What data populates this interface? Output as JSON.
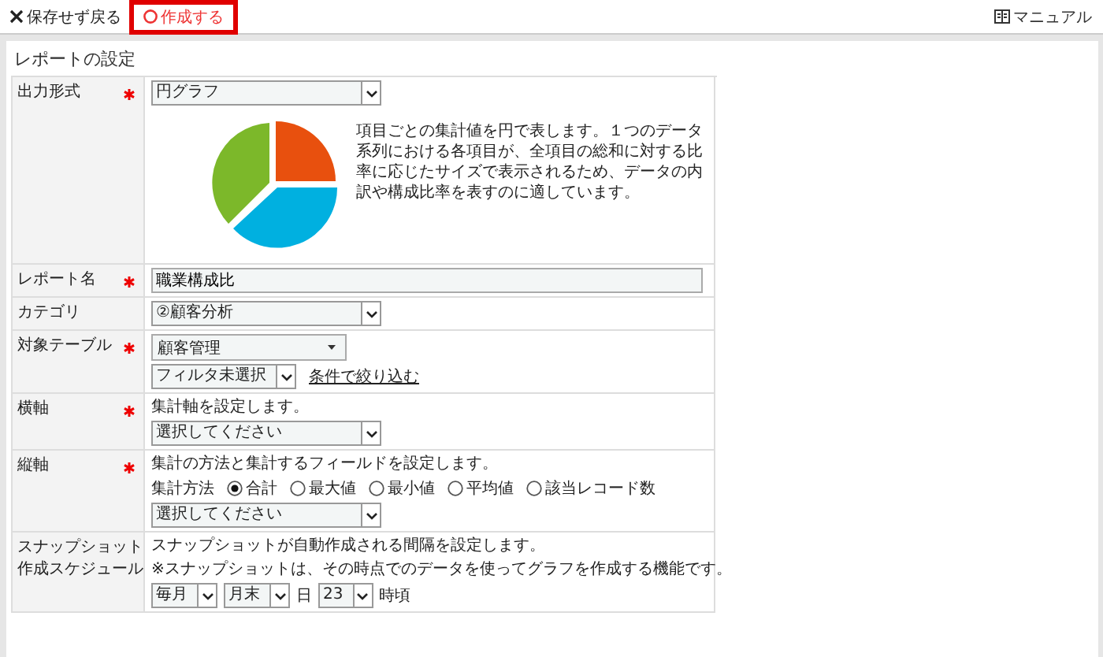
{
  "toolbar": {
    "back_button": {
      "label": "保存せず戻る"
    },
    "create_button": {
      "label": "作成する",
      "highlighted": true
    },
    "manual_link": {
      "label": "マニュアル"
    }
  },
  "panel": {
    "title": "レポートの設定",
    "rows": [
      {
        "label": [
          "出力形式"
        ],
        "required": true,
        "lines": [
          [
            {
              "kind": "select",
              "value": "円グラフ"
            }
          ],
          [
            {
              "kind": "preview",
              "description": "項目ごとの集計値を円で表します。１つのデータ系列における各項目が、全項目の総和に対する比率に応じたサイズで表示されるため、データの内訳や構成比率を表すのに適しています。"
            }
          ]
        ]
      },
      {
        "label": [
          "レポート名"
        ],
        "required": true,
        "lines": [
          [
            {
              "kind": "text_input",
              "value": "職業構成比"
            }
          ]
        ]
      },
      {
        "label": [
          "カテゴリ"
        ],
        "required": false,
        "lines": [
          [
            {
              "kind": "select",
              "value": "②顧客分析"
            }
          ]
        ]
      },
      {
        "label": [
          "対象テーブル"
        ],
        "required": true,
        "lines": [
          [
            {
              "kind": "dropdown",
              "value": "顧客管理"
            }
          ],
          [
            {
              "kind": "select",
              "value": "フィルタ未選択"
            },
            {
              "kind": "link",
              "label": "条件で絞り込む"
            }
          ]
        ]
      },
      {
        "label": [
          "横軸"
        ],
        "required": true,
        "lines": [
          [
            {
              "kind": "note",
              "text": "集計軸を設定します。"
            }
          ],
          [
            {
              "kind": "select",
              "value": "選択してください"
            }
          ]
        ]
      },
      {
        "label": [
          "縦軸"
        ],
        "required": true,
        "lines": [
          [
            {
              "kind": "note",
              "text": "集計の方法と集計するフィールドを設定します。"
            }
          ],
          [
            {
              "kind": "note",
              "text": "集計方法"
            },
            {
              "kind": "radio_group",
              "options": [
                {
                  "label": "合計",
                  "selected": true
                },
                {
                  "label": "最大値",
                  "selected": false
                },
                {
                  "label": "最小値",
                  "selected": false
                },
                {
                  "label": "平均値",
                  "selected": false
                },
                {
                  "label": "該当レコード数",
                  "selected": false
                }
              ]
            }
          ],
          [
            {
              "kind": "select",
              "value": "選択してください"
            }
          ]
        ]
      },
      {
        "label": [
          "スナップショット",
          "作成スケジュール"
        ],
        "required": false,
        "lines": [
          [
            {
              "kind": "note",
              "text": "スナップショットが自動作成される間隔を設定します。"
            }
          ],
          [
            {
              "kind": "note",
              "text": "※スナップショットは、その時点でのデータを使ってグラフを作成する機能です。"
            }
          ],
          [
            {
              "kind": "select",
              "value": "毎月"
            },
            {
              "kind": "select",
              "value": "月末"
            },
            {
              "kind": "note",
              "text": "日"
            },
            {
              "kind": "select",
              "value": "23"
            },
            {
              "kind": "note",
              "text": "時頃"
            }
          ]
        ]
      }
    ]
  }
}
